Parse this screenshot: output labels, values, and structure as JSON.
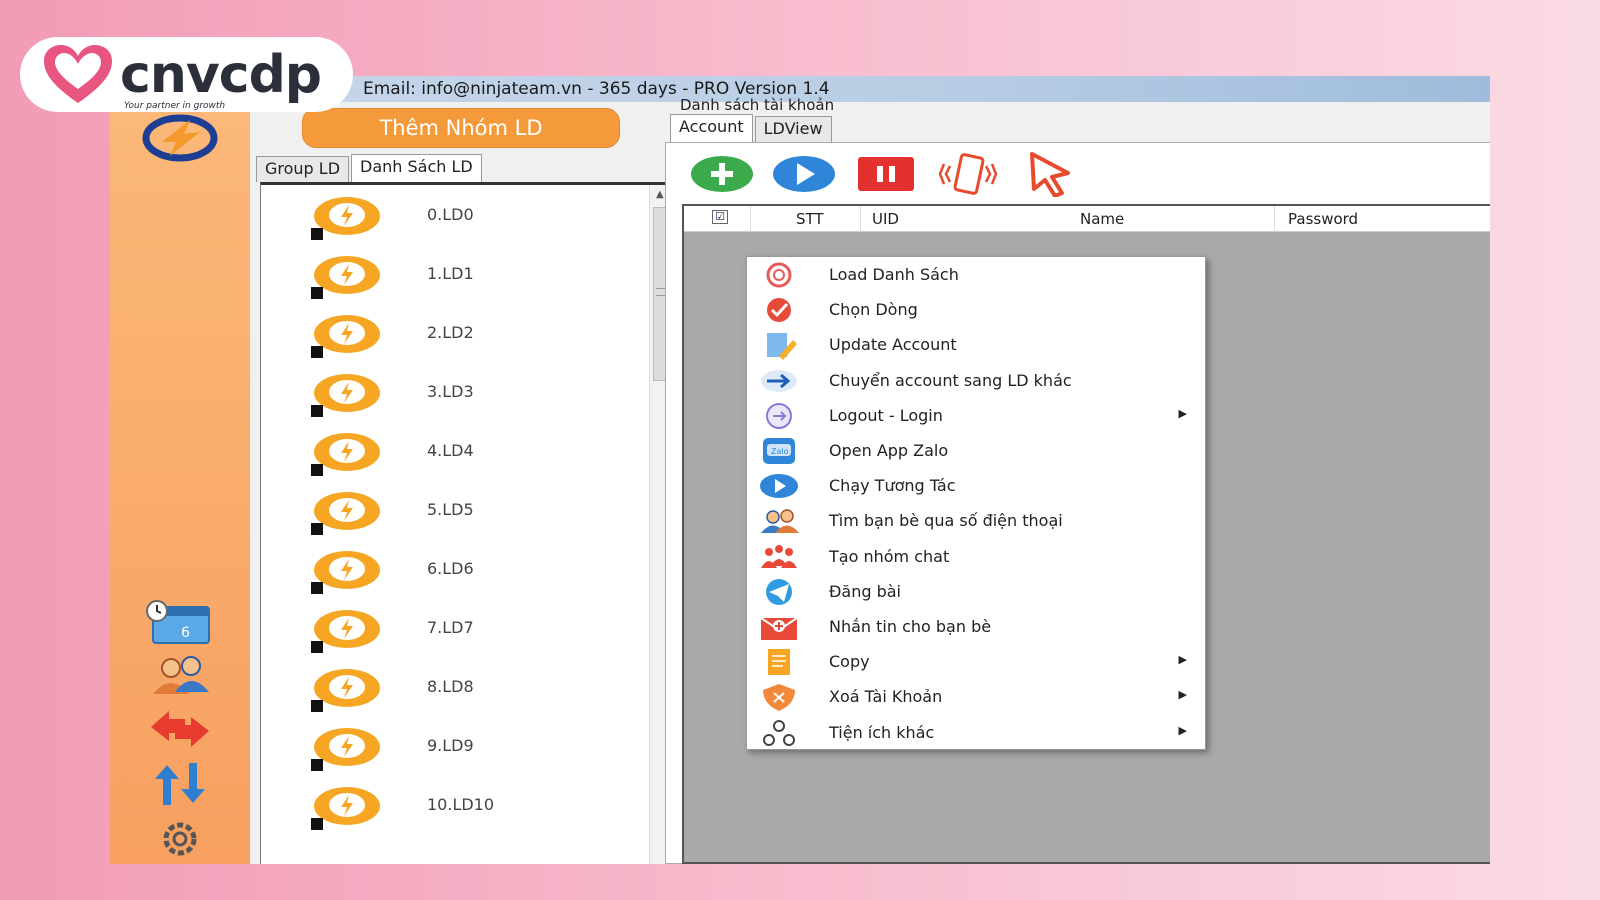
{
  "brand": {
    "name": "cnvcdp",
    "tagline": "Your partner in growth",
    "color": "#e8557f"
  },
  "window": {
    "title": "Email: info@ninjateam.vn - 365 days - PRO Version 1.4"
  },
  "sidebar": {
    "icons": [
      "app-logo-icon",
      "calendar-icon",
      "users-icon",
      "sync-arrows-icon",
      "sort-arrows-icon",
      "gear-icon"
    ]
  },
  "group_panel": {
    "add_button": "Thêm Nhóm LD",
    "tabs": [
      {
        "label": "Group LD",
        "active": false
      },
      {
        "label": "Danh Sách LD",
        "active": true
      }
    ],
    "items": [
      "0.LD0",
      "1.LD1",
      "2.LD2",
      "3.LD3",
      "4.LD4",
      "5.LD5",
      "6.LD6",
      "7.LD7",
      "8.LD8",
      "9.LD9",
      "10.LD10"
    ]
  },
  "account_panel": {
    "title": "Danh sách tài khoản",
    "tabs": [
      {
        "label": "Account",
        "active": true
      },
      {
        "label": "LDView",
        "active": false
      }
    ],
    "toolbar": [
      "add-icon",
      "play-icon",
      "pause-icon",
      "phone-shake-icon",
      "cursor-icon"
    ],
    "columns": [
      "STT",
      "UID",
      "Name",
      "Password"
    ],
    "select_all": "☑"
  },
  "context_menu": {
    "items": [
      {
        "label": "Load Danh Sách",
        "icon": "reload-icon",
        "submenu": false
      },
      {
        "label": "Chọn Dòng",
        "icon": "check-circle-icon",
        "submenu": false
      },
      {
        "label": "Update Account",
        "icon": "edit-document-icon",
        "submenu": false
      },
      {
        "label": "Chuyển account sang LD khác",
        "icon": "arrow-right-icon",
        "submenu": false
      },
      {
        "label": "Logout - Login",
        "icon": "logout-icon",
        "submenu": true
      },
      {
        "label": "Open App Zalo",
        "icon": "zalo-icon",
        "submenu": false
      },
      {
        "label": "Chạy Tương Tác",
        "icon": "play-circle-icon",
        "submenu": false
      },
      {
        "label": "Tìm bạn bè qua số điện thoại",
        "icon": "find-friends-icon",
        "submenu": false
      },
      {
        "label": "Tạo nhóm chat",
        "icon": "group-chat-icon",
        "submenu": false
      },
      {
        "label": "Đăng bài",
        "icon": "telegram-icon",
        "submenu": false
      },
      {
        "label": "Nhắn tin cho bạn bè",
        "icon": "mail-icon",
        "submenu": false
      },
      {
        "label": "Copy",
        "icon": "copy-icon",
        "submenu": true
      },
      {
        "label": "Xoá Tài Khoản",
        "icon": "delete-shield-icon",
        "submenu": true
      },
      {
        "label": "Tiện ích khác",
        "icon": "utilities-icon",
        "submenu": true
      }
    ],
    "submenu_arrow": "▶"
  }
}
